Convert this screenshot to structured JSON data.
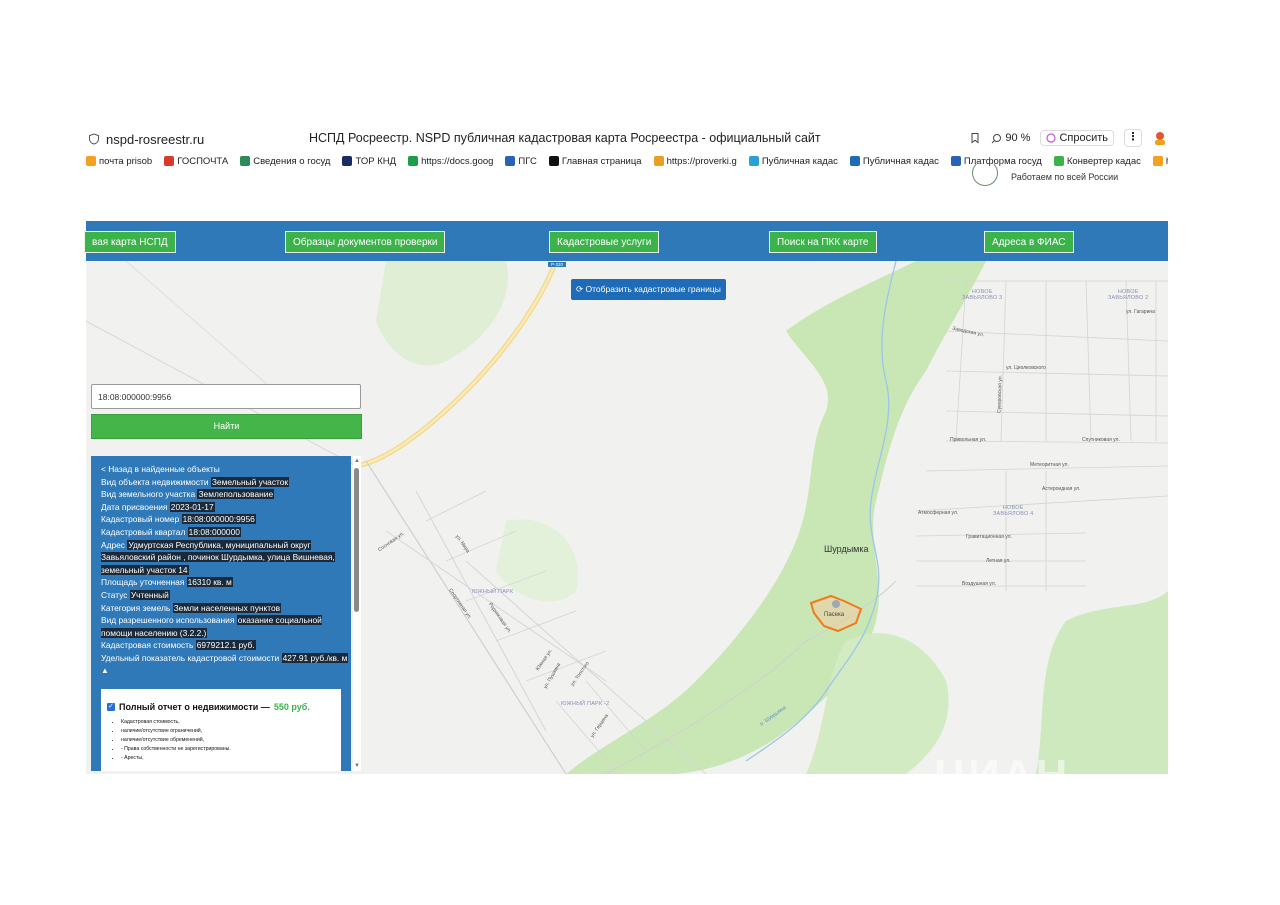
{
  "browser": {
    "url": "nspd-rosreestr.ru",
    "title": "НСПД Росреестр. NSPD публичная кадастровая карта Росреестра - официальный сайт",
    "zoom": "90 %",
    "ask": "Спросить",
    "bookmarks": [
      {
        "label": "почта prisob",
        "color": "#f4a020"
      },
      {
        "label": "ГОСПОЧТА",
        "color": "#d83a2a"
      },
      {
        "label": "Сведения о госуд",
        "color": "#2e8b57"
      },
      {
        "label": "ТОР КНД",
        "color": "#1c2a66"
      },
      {
        "label": "https://docs.goog",
        "color": "#1e9e4a"
      },
      {
        "label": "ПГС",
        "color": "#2a62b8"
      },
      {
        "label": "Главная страница",
        "color": "#111111"
      },
      {
        "label": "https://proverki.g",
        "color": "#e8a020"
      },
      {
        "label": "Публичная кадас",
        "color": "#2aa0d8"
      },
      {
        "label": "Публичная кадас",
        "color": "#1e6bb8"
      },
      {
        "label": "Платформа госуд",
        "color": "#2a62b8"
      },
      {
        "label": "Конвертер кадас",
        "color": "#3bb34a"
      },
      {
        "label": "https://s",
        "color": "#f4a020"
      }
    ],
    "works_note": "Работаем по всей России"
  },
  "nav": {
    "items": [
      "вая карта НСПД",
      "Образцы документов проверки",
      "Кадастровые услуги",
      "Поиск на ПКК карте",
      "Адреса в ФИАС"
    ]
  },
  "map": {
    "cadastral_button": "Отобразить кадастровые границы",
    "road_badge": "Р-320",
    "village": "Шурдымка",
    "parcel_label": "Пасека",
    "watermark": "ЦИАН",
    "labels": {
      "nz3": "НОВОЕ\nЗАВЬЯЛОВО 3",
      "nz2": "НОВОЕ\nЗАВЬЯЛОВО 2",
      "nz4": "НОВОЕ\nЗАВЬЯЛОВО 4",
      "yp": "ЮЖНЫЙ ПАРК",
      "yp2": "ЮЖНЫЙ ПАРК -2",
      "zavod": "Заводская ул.",
      "ciolk": "ул. Циолковского",
      "privol": "Привольная ул.",
      "sputnik": "Спутниковая ул.",
      "meteor": "Метеоритная ул.",
      "asteroid": "Астероидная ул.",
      "atmos": "Атмосферная ул.",
      "gravit": "Гравитационная ул.",
      "letnaya": "Летная ул.",
      "vozdush": "Воздушная ул.",
      "gagarin": "ул. Гагарина",
      "suvorov": "Суворовская ул.",
      "mira": "ул. Мира",
      "sosn": "Сосновая ул.",
      "rodnik": "Родниковая ул.",
      "sportiv": "Спортивная ул.",
      "ulitsa": "Южная ул.",
      "pushkin": "ул. Пушкина",
      "tolstoy": "ул. Толстого",
      "gerzen": "ул. Герцена",
      "shurd_river": "р. Шурдымка"
    }
  },
  "search": {
    "value": "18:08:000000:9956",
    "button": "Найти"
  },
  "panel": {
    "back": "< Назад в найденные объекты",
    "rows": [
      {
        "k": "Вид объекта недвижимости",
        "v": "Земельный участок"
      },
      {
        "k": "Вид земельного участка",
        "v": "Землепользование"
      },
      {
        "k": "Дата присвоения",
        "v": "2023-01-17"
      },
      {
        "k": "Кадастровый номер",
        "v": "18:08:000000:9956"
      },
      {
        "k": "Кадастровый квартал",
        "v": "18:08:000000"
      },
      {
        "k": "Адрес",
        "v": "Удмуртская Республика, муниципальный округ Завьяловский район , починок Шурдымка, улица Вишневая, земельный участок 14"
      },
      {
        "k": "Площадь уточненная",
        "v": "16310 кв. м"
      },
      {
        "k": "Статус",
        "v": "Учтенный"
      },
      {
        "k": "Категория земель",
        "v": "Земли населенных пунктов"
      },
      {
        "k": "Вид разрешенного использования",
        "v": "оказание социальной помощи населению (3.2.2.)"
      },
      {
        "k": "Кадастровая стоимость",
        "v": "6979212.1 руб."
      },
      {
        "k": "Удельный показатель кадастровой стоимости",
        "v": "427.91 руб./кв. м"
      }
    ],
    "collapse": "▲",
    "report_title": "Полный отчет о недвижимости — ",
    "report_price": "550 руб.",
    "report_items": [
      "Кадастровая стоимость,",
      "наличие/отсутствие ограничений,",
      "наличие/отсутствие обременений,",
      "- Права собственности не зарегистрированы.",
      "- Аресты,"
    ]
  }
}
